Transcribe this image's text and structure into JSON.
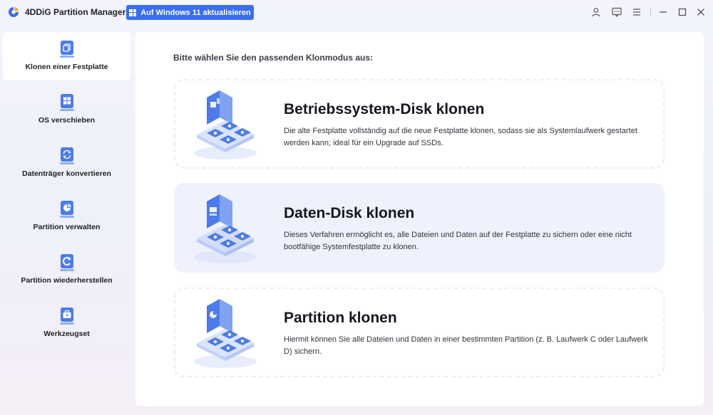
{
  "titlebar": {
    "app_name": "4DDiG Partition Manager",
    "upgrade_label": "Auf Windows 11 aktualisieren",
    "icons": [
      "account-icon",
      "feedback-icon",
      "menu-icon",
      "minimize-icon",
      "maximize-icon",
      "close-icon"
    ]
  },
  "sidebar": {
    "items": [
      {
        "label": "Klonen einer Festplatte",
        "icon": "disk-clone-icon",
        "active": true
      },
      {
        "label": "OS verschieben",
        "icon": "windows-os-icon",
        "active": false
      },
      {
        "label": "Datenträger konvertieren",
        "icon": "convert-icon",
        "active": false
      },
      {
        "label": "Partition verwalten",
        "icon": "pie-partition-icon",
        "active": false
      },
      {
        "label": "Partition wiederherstellen",
        "icon": "recover-icon",
        "active": false
      },
      {
        "label": "Werkzeugset",
        "icon": "toolbox-icon",
        "active": false
      }
    ]
  },
  "main": {
    "prompt": "Bitte wählen Sie den passenden Klonmodus aus:",
    "cards": [
      {
        "title": "Betriebssystem-Disk klonen",
        "description": "Die alte Festplatte vollständig auf die neue Festplatte klonen, sodass sie als Systemlaufwerk gestartet werden kann; ideal für ein Upgrade auf SSDs.",
        "selected": false
      },
      {
        "title": "Daten-Disk klonen",
        "description": "Dieses Verfahren ermöglicht es, alle Dateien und Daten auf der Festplatte zu sichern oder eine nicht bootfähige Systemfestplatte zu klonen.",
        "selected": true
      },
      {
        "title": "Partition klonen",
        "description": "Hiermit können Sie alle Dateien und Daten in einer bestimmten Partition (z. B. Laufwerk C oder Laufwerk D) sichern.",
        "selected": false
      }
    ]
  },
  "colors": {
    "accent": "#3a6df0",
    "selected_card": "#eff1fd",
    "illustration_blue": "#4b7bec"
  }
}
